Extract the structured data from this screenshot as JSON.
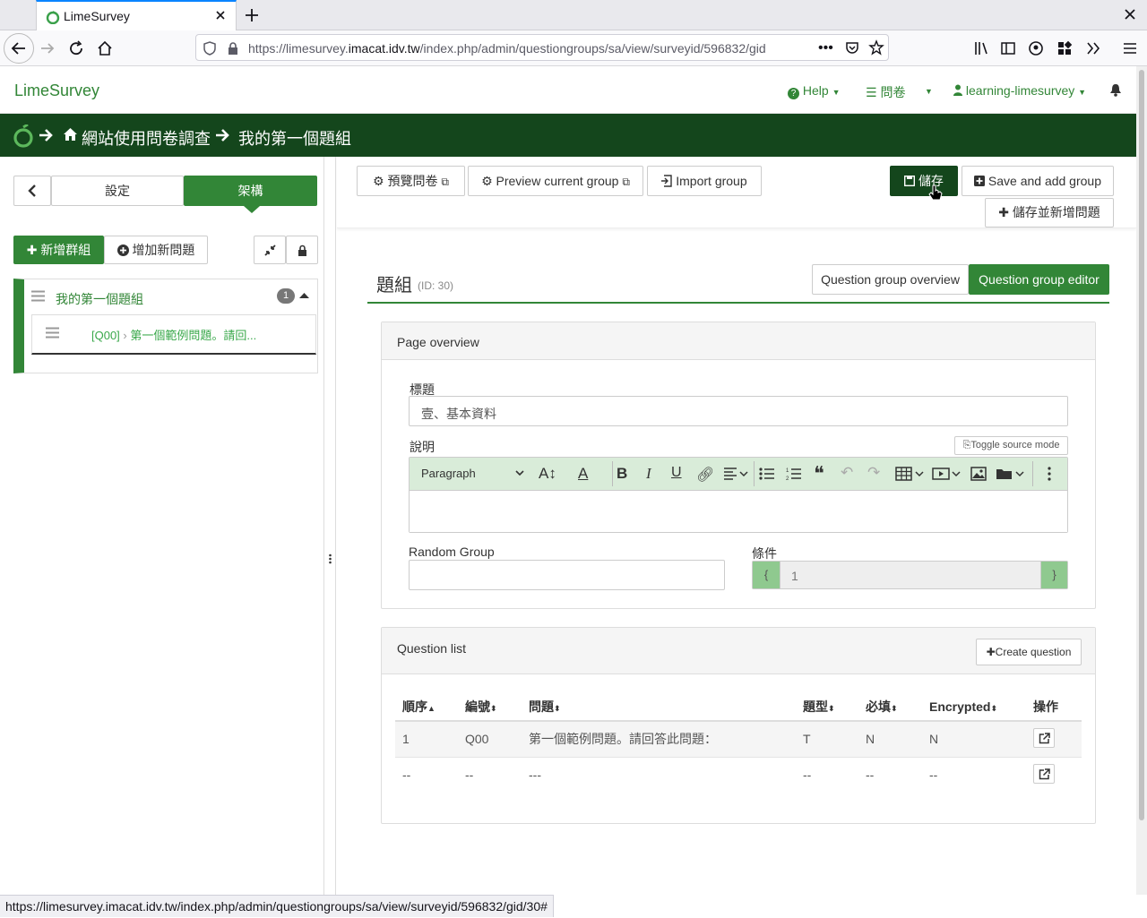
{
  "browser": {
    "tab_title": "LimeSurvey",
    "url_prefix": "https://limesurvey.",
    "url_domain": "imacat.idv.tw",
    "url_path": "/index.php/admin/questiongroups/sa/view/surveyid/596832/gid",
    "status_url": "https://limesurvey.imacat.idv.tw/index.php/admin/questiongroups/sa/view/surveyid/596832/gid/30#"
  },
  "header": {
    "brand": "LimeSurvey",
    "help": "Help",
    "surveys": "問卷",
    "user": "learning-limesurvey"
  },
  "breadcrumb": {
    "survey": "網站使用問卷調查",
    "group": "我的第一個題組"
  },
  "sidebar": {
    "tab_settings": "設定",
    "tab_structure": "架構",
    "add_group": "新增群組",
    "add_question": "增加新問題",
    "group_name": "我的第一個題組",
    "group_count": "1",
    "question_code": "[Q00]",
    "question_text": "第一個範例問題。請回..."
  },
  "toolbar": {
    "preview_survey": "預覽問卷",
    "preview_group": "Preview current group",
    "import_group": "Import group",
    "save": "儲存",
    "save_add_group": "Save and add group",
    "save_add_question": "儲存並新增問題"
  },
  "editor": {
    "title": "題組",
    "id_label": "(ID: 30)",
    "tab_overview": "Question group overview",
    "tab_editor": "Question group editor",
    "page_overview": "Page overview",
    "title_label": "標題",
    "title_value": "壹、基本資料",
    "description_label": "說明",
    "toggle_source": "Toggle source mode",
    "paragraph": "Paragraph",
    "random_group_label": "Random Group",
    "random_group_value": "",
    "condition_label": "條件",
    "condition_open": "{",
    "condition_value": "1",
    "condition_close": "}"
  },
  "question_list": {
    "title": "Question list",
    "create_button": "Create question",
    "columns": [
      "順序",
      "編號",
      "問題",
      "題型",
      "必填",
      "Encrypted",
      "操作"
    ],
    "rows": [
      [
        "1",
        "Q00",
        "第一個範例問題。請回答此問題：",
        "T",
        "N",
        "N"
      ],
      [
        "--",
        "--",
        "---",
        "--",
        "--",
        "--"
      ]
    ]
  },
  "colors": {
    "brand_green": "#328637",
    "dark_green": "#14461c"
  }
}
